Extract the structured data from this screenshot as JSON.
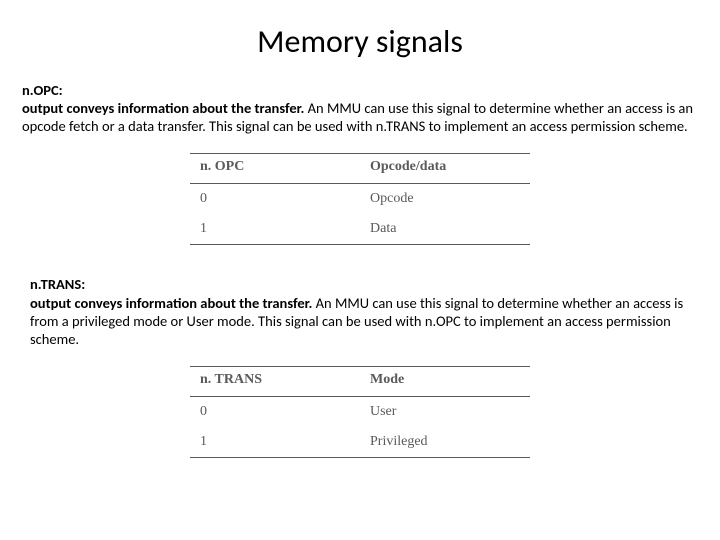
{
  "title": "Memory signals",
  "section1": {
    "heading": "n.OPC:",
    "lead": "output conveys information about the transfer.",
    "rest": " An MMU can use this signal to determine whether an access is an opcode fetch or a data transfer. This signal can be used with n.TRANS to implement an access permission scheme."
  },
  "table1": {
    "headers": [
      "n. OPC",
      "Opcode/data"
    ],
    "rows": [
      [
        "0",
        "Opcode"
      ],
      [
        "1",
        "Data"
      ]
    ]
  },
  "section2": {
    "heading": "n.TRANS:",
    "lead": "output conveys information about the transfer.",
    "rest": " An MMU can use this signal to determine whether an access is from a privileged mode or User mode. This signal can be used with n.OPC to implement an access permission scheme."
  },
  "table2": {
    "headers": [
      "n. TRANS",
      "Mode"
    ],
    "rows": [
      [
        "0",
        "User"
      ],
      [
        "1",
        "Privileged"
      ]
    ]
  }
}
